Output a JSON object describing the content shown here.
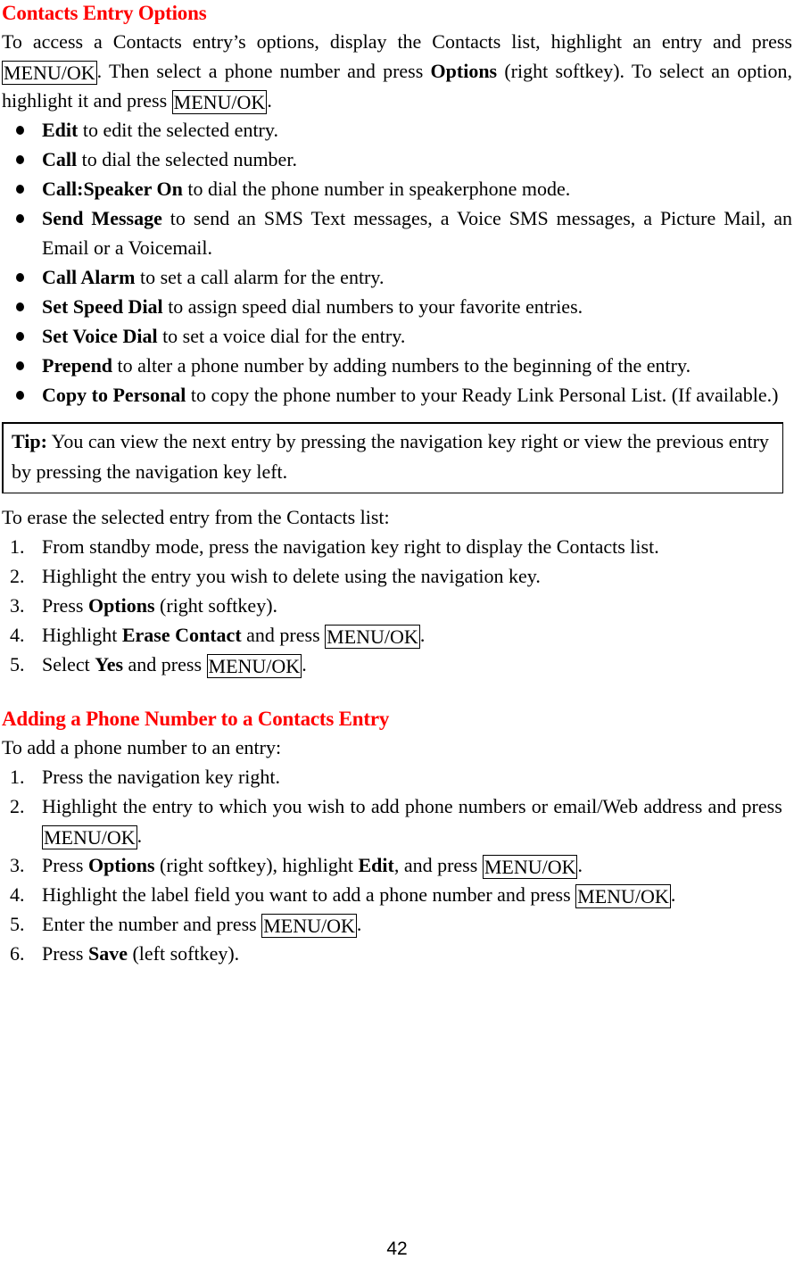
{
  "document": {
    "page_number": "42",
    "heading_color": "#ff0000"
  },
  "section1": {
    "heading": "Contacts Entry Options",
    "intro": {
      "p1_a": "To access a Contacts entry’s options, display the Contacts list, highlight an entry and press ",
      "key1": "MENU/OK",
      "p1_b": ". Then select a phone number and press ",
      "bold1": "Options",
      "p1_c": " (right softkey). To select an option, highlight it and press ",
      "key2": "MENU/OK",
      "p1_d": "."
    },
    "options": [
      {
        "label": "Edit",
        "text": " to edit the selected entry."
      },
      {
        "label": "Call",
        "text": " to dial the selected number."
      },
      {
        "label": "Call:Speaker On",
        "text": " to dial the phone number in speakerphone mode."
      },
      {
        "label": "Send Message",
        "text": " to send an SMS Text messages, a Voice SMS messages, a Picture Mail, an Email or a Voicemail."
      },
      {
        "label": "Call Alarm",
        "text": " to set a call alarm for the entry."
      },
      {
        "label": "Set Speed Dial",
        "text": " to assign speed dial numbers to your favorite entries."
      },
      {
        "label": "Set Voice Dial",
        "text": " to set a voice dial for the entry."
      },
      {
        "label": "Prepend",
        "text": " to alter a phone number by adding numbers to the beginning of the entry."
      },
      {
        "label": "Copy to Personal",
        "text": " to copy the phone number to your Ready Link Personal List. (If available.)"
      }
    ],
    "tip": {
      "label": "Tip:",
      "text": " You can view the next entry by pressing the navigation key right or view the previous entry by pressing the navigation key left."
    },
    "erase_intro": "To erase the selected entry from the Contacts list:",
    "erase_steps": [
      {
        "num": "1.",
        "a": "From standby mode, press the navigation key right to display the Contacts list."
      },
      {
        "num": "2.",
        "a": "Highlight the entry you wish to delete using the navigation key."
      },
      {
        "num": "3.",
        "a": "Press ",
        "bold": "Options",
        "b": " (right softkey)."
      },
      {
        "num": "4.",
        "a": "Highlight ",
        "bold": "Erase Contact",
        "b": " and press ",
        "key": "MENU/OK",
        "c": "."
      },
      {
        "num": "5.",
        "a": "Select ",
        "bold": "Yes",
        "b": " and press ",
        "key": "MENU/OK",
        "c": "."
      }
    ]
  },
  "section2": {
    "heading": "Adding a Phone Number to a Contacts Entry",
    "intro": "To add a phone number to an entry:",
    "steps": [
      {
        "num": "1.",
        "a": "Press the navigation key right."
      },
      {
        "num": "2.",
        "a": "Highlight the entry to which you wish to add phone numbers or email/Web address and press ",
        "key": "MENU/OK",
        "b": "."
      },
      {
        "num": "3.",
        "a": "Press ",
        "bold": "Options",
        "b": " (right softkey), highlight ",
        "bold2": "Edit",
        "c": ", and press ",
        "key": "MENU/OK",
        "d": "."
      },
      {
        "num": "4.",
        "a": "Highlight the label field you want to add a phone number and press ",
        "key": "MENU/OK",
        "b": "."
      },
      {
        "num": "5.",
        "a": "Enter the number and press ",
        "key": "MENU/OK",
        "b": "."
      },
      {
        "num": "6.",
        "a": "Press ",
        "bold": "Save",
        "b": " (left softkey)."
      }
    ]
  }
}
